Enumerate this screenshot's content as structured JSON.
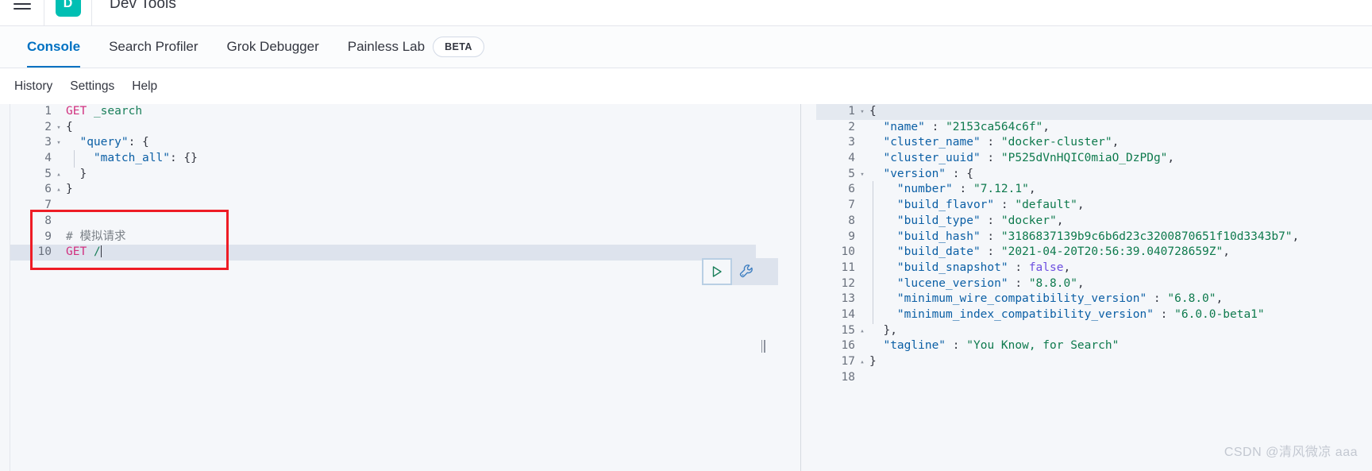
{
  "header": {
    "menu_icon": "hamburger-menu-icon",
    "app_badge_letter": "D",
    "app_badge_color": "#00bfb3",
    "title": "Dev Tools"
  },
  "tabs": [
    {
      "label": "Console",
      "active": true,
      "badge": null
    },
    {
      "label": "Search Profiler",
      "active": false,
      "badge": null
    },
    {
      "label": "Grok Debugger",
      "active": false,
      "badge": null
    },
    {
      "label": "Painless Lab",
      "active": false,
      "badge": "BETA"
    }
  ],
  "subnav": [
    {
      "label": "History"
    },
    {
      "label": "Settings"
    },
    {
      "label": "Help"
    }
  ],
  "request_editor": {
    "name": "console-request-editor",
    "active_line": 10,
    "lines": [
      {
        "n": 1,
        "fold": "",
        "indent": false,
        "tokens": [
          {
            "t": "GET",
            "c": "k-method"
          },
          {
            "t": " ",
            "c": "k-punct"
          },
          {
            "t": "_search",
            "c": "k-url"
          }
        ]
      },
      {
        "n": 2,
        "fold": "▾",
        "indent": false,
        "tokens": [
          {
            "t": "{",
            "c": "k-punct"
          }
        ]
      },
      {
        "n": 3,
        "fold": "▾",
        "indent": false,
        "tokens": [
          {
            "t": "  ",
            "c": "k-punct"
          },
          {
            "t": "\"query\"",
            "c": "k-key"
          },
          {
            "t": ": {",
            "c": "k-punct"
          }
        ]
      },
      {
        "n": 4,
        "fold": "",
        "indent": true,
        "tokens": [
          {
            "t": "    ",
            "c": "k-punct"
          },
          {
            "t": "\"match_all\"",
            "c": "k-key"
          },
          {
            "t": ": {}",
            "c": "k-punct"
          }
        ]
      },
      {
        "n": 5,
        "fold": "▴",
        "indent": false,
        "tokens": [
          {
            "t": "  }",
            "c": "k-punct"
          }
        ]
      },
      {
        "n": 6,
        "fold": "▴",
        "indent": false,
        "tokens": [
          {
            "t": "}",
            "c": "k-punct"
          }
        ]
      },
      {
        "n": 7,
        "fold": "",
        "indent": false,
        "tokens": []
      },
      {
        "n": 8,
        "fold": "",
        "indent": false,
        "tokens": []
      },
      {
        "n": 9,
        "fold": "",
        "indent": false,
        "tokens": [
          {
            "t": "# 模拟请求",
            "c": "k-comment"
          }
        ]
      },
      {
        "n": 10,
        "fold": "",
        "indent": false,
        "tokens": [
          {
            "t": "GET",
            "c": "k-method"
          },
          {
            "t": " ",
            "c": "k-punct"
          },
          {
            "t": "/",
            "c": "k-url"
          }
        ],
        "caret": true
      }
    ]
  },
  "response_editor": {
    "name": "console-response-viewer",
    "active_line": 1,
    "lines": [
      {
        "n": 1,
        "fold": "▾",
        "indent": false,
        "tokens": [
          {
            "t": "{",
            "c": "k-punct"
          }
        ]
      },
      {
        "n": 2,
        "fold": "",
        "indent": false,
        "tokens": [
          {
            "t": "  ",
            "c": "k-punct"
          },
          {
            "t": "\"name\"",
            "c": "k-key"
          },
          {
            "t": " : ",
            "c": "k-punct"
          },
          {
            "t": "\"2153ca564c6f\"",
            "c": "k-str"
          },
          {
            "t": ",",
            "c": "k-punct"
          }
        ]
      },
      {
        "n": 3,
        "fold": "",
        "indent": false,
        "tokens": [
          {
            "t": "  ",
            "c": "k-punct"
          },
          {
            "t": "\"cluster_name\"",
            "c": "k-key"
          },
          {
            "t": " : ",
            "c": "k-punct"
          },
          {
            "t": "\"docker-cluster\"",
            "c": "k-str"
          },
          {
            "t": ",",
            "c": "k-punct"
          }
        ]
      },
      {
        "n": 4,
        "fold": "",
        "indent": false,
        "tokens": [
          {
            "t": "  ",
            "c": "k-punct"
          },
          {
            "t": "\"cluster_uuid\"",
            "c": "k-key"
          },
          {
            "t": " : ",
            "c": "k-punct"
          },
          {
            "t": "\"P525dVnHQIC0miaO_DzPDg\"",
            "c": "k-str"
          },
          {
            "t": ",",
            "c": "k-punct"
          }
        ]
      },
      {
        "n": 5,
        "fold": "▾",
        "indent": false,
        "tokens": [
          {
            "t": "  ",
            "c": "k-punct"
          },
          {
            "t": "\"version\"",
            "c": "k-key"
          },
          {
            "t": " : {",
            "c": "k-punct"
          }
        ]
      },
      {
        "n": 6,
        "fold": "",
        "indent": true,
        "tokens": [
          {
            "t": "    ",
            "c": "k-punct"
          },
          {
            "t": "\"number\"",
            "c": "k-key"
          },
          {
            "t": " : ",
            "c": "k-punct"
          },
          {
            "t": "\"7.12.1\"",
            "c": "k-str"
          },
          {
            "t": ",",
            "c": "k-punct"
          }
        ]
      },
      {
        "n": 7,
        "fold": "",
        "indent": true,
        "tokens": [
          {
            "t": "    ",
            "c": "k-punct"
          },
          {
            "t": "\"build_flavor\"",
            "c": "k-key"
          },
          {
            "t": " : ",
            "c": "k-punct"
          },
          {
            "t": "\"default\"",
            "c": "k-str"
          },
          {
            "t": ",",
            "c": "k-punct"
          }
        ]
      },
      {
        "n": 8,
        "fold": "",
        "indent": true,
        "tokens": [
          {
            "t": "    ",
            "c": "k-punct"
          },
          {
            "t": "\"build_type\"",
            "c": "k-key"
          },
          {
            "t": " : ",
            "c": "k-punct"
          },
          {
            "t": "\"docker\"",
            "c": "k-str"
          },
          {
            "t": ",",
            "c": "k-punct"
          }
        ]
      },
      {
        "n": 9,
        "fold": "",
        "indent": true,
        "tokens": [
          {
            "t": "    ",
            "c": "k-punct"
          },
          {
            "t": "\"build_hash\"",
            "c": "k-key"
          },
          {
            "t": " : ",
            "c": "k-punct"
          },
          {
            "t": "\"3186837139b9c6b6d23c3200870651f10d3343b7\"",
            "c": "k-str"
          },
          {
            "t": ",",
            "c": "k-punct"
          }
        ]
      },
      {
        "n": 10,
        "fold": "",
        "indent": true,
        "tokens": [
          {
            "t": "    ",
            "c": "k-punct"
          },
          {
            "t": "\"build_date\"",
            "c": "k-key"
          },
          {
            "t": " : ",
            "c": "k-punct"
          },
          {
            "t": "\"2021-04-20T20:56:39.040728659Z\"",
            "c": "k-str"
          },
          {
            "t": ",",
            "c": "k-punct"
          }
        ]
      },
      {
        "n": 11,
        "fold": "",
        "indent": true,
        "tokens": [
          {
            "t": "    ",
            "c": "k-punct"
          },
          {
            "t": "\"build_snapshot\"",
            "c": "k-key"
          },
          {
            "t": " : ",
            "c": "k-punct"
          },
          {
            "t": "false",
            "c": "k-bool"
          },
          {
            "t": ",",
            "c": "k-punct"
          }
        ]
      },
      {
        "n": 12,
        "fold": "",
        "indent": true,
        "tokens": [
          {
            "t": "    ",
            "c": "k-punct"
          },
          {
            "t": "\"lucene_version\"",
            "c": "k-key"
          },
          {
            "t": " : ",
            "c": "k-punct"
          },
          {
            "t": "\"8.8.0\"",
            "c": "k-str"
          },
          {
            "t": ",",
            "c": "k-punct"
          }
        ]
      },
      {
        "n": 13,
        "fold": "",
        "indent": true,
        "tokens": [
          {
            "t": "    ",
            "c": "k-punct"
          },
          {
            "t": "\"minimum_wire_compatibility_version\"",
            "c": "k-key"
          },
          {
            "t": " : ",
            "c": "k-punct"
          },
          {
            "t": "\"6.8.0\"",
            "c": "k-str"
          },
          {
            "t": ",",
            "c": "k-punct"
          }
        ]
      },
      {
        "n": 14,
        "fold": "",
        "indent": true,
        "tokens": [
          {
            "t": "    ",
            "c": "k-punct"
          },
          {
            "t": "\"minimum_index_compatibility_version\"",
            "c": "k-key"
          },
          {
            "t": " : ",
            "c": "k-punct"
          },
          {
            "t": "\"6.0.0-beta1\"",
            "c": "k-str"
          }
        ]
      },
      {
        "n": 15,
        "fold": "▴",
        "indent": false,
        "tokens": [
          {
            "t": "  },",
            "c": "k-punct"
          }
        ]
      },
      {
        "n": 16,
        "fold": "",
        "indent": false,
        "tokens": [
          {
            "t": "  ",
            "c": "k-punct"
          },
          {
            "t": "\"tagline\"",
            "c": "k-key"
          },
          {
            "t": " : ",
            "c": "k-punct"
          },
          {
            "t": "\"You Know, for Search\"",
            "c": "k-str"
          }
        ]
      },
      {
        "n": 17,
        "fold": "▴",
        "indent": false,
        "tokens": [
          {
            "t": "}",
            "c": "k-punct"
          }
        ]
      },
      {
        "n": 18,
        "fold": "",
        "indent": false,
        "tokens": []
      }
    ]
  },
  "actions": {
    "play_icon": "play-triangle-icon",
    "play_color": "#1a7f5a",
    "wrench_icon": "wrench-icon",
    "wrench_color": "#3e7fc1"
  },
  "annotation": {
    "box_color": "#ee1c25",
    "name": "red-highlight-box"
  },
  "watermark": {
    "text": "CSDN @清风微凉 aaa"
  }
}
